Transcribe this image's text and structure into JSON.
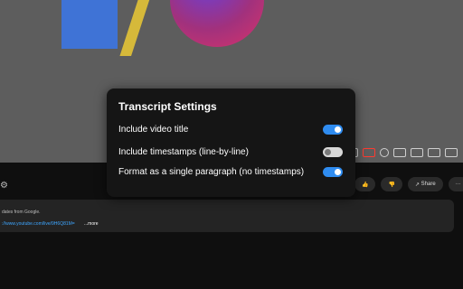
{
  "page": {
    "background": "#0b0b0b"
  },
  "player": {
    "controls": [
      "shield-icon",
      "cc-icon",
      "youtube-icon",
      "settings-icon",
      "miniplayer-icon",
      "theater-icon",
      "cast-icon",
      "fullscreen-icon"
    ]
  },
  "actions": {
    "like_label": "",
    "dislike_label": "",
    "share_label": "Share",
    "more_label": "···"
  },
  "description": {
    "line1": "dates from Google.",
    "link": "://www.youtube.com/live/9H6Q81M=",
    "more": "...more"
  },
  "dialog": {
    "title": "Transcript Settings",
    "options": [
      {
        "label": "Include video title",
        "enabled": true
      },
      {
        "label": "Include timestamps (line-by-line)",
        "enabled": false
      },
      {
        "label": "Format as a single paragraph (no timestamps)",
        "enabled": true
      }
    ]
  }
}
